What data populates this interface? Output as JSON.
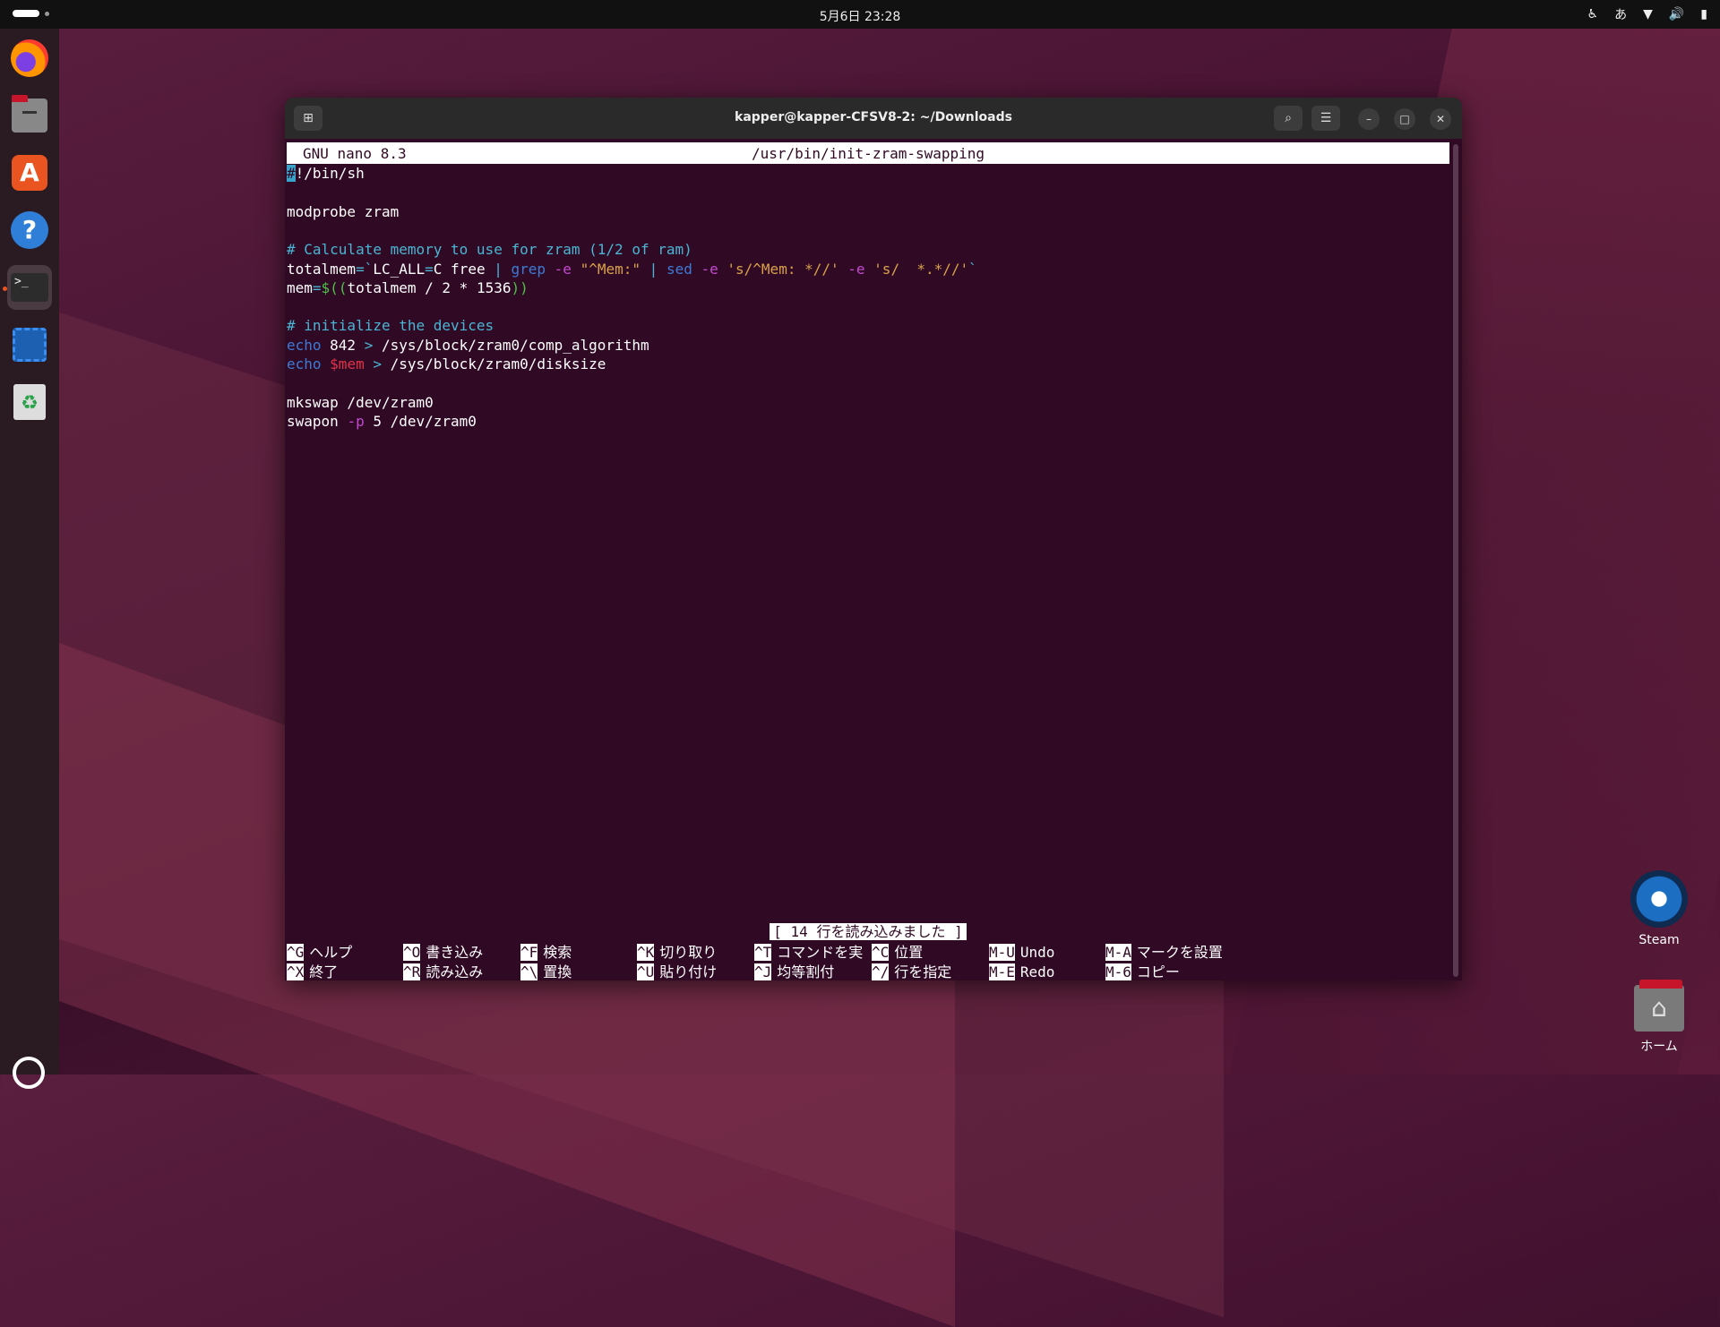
{
  "topbar": {
    "clock": "5月6日  23:28",
    "ime": "あ"
  },
  "dock": {
    "items": [
      {
        "name": "firefox",
        "active": false
      },
      {
        "name": "files",
        "active": false
      },
      {
        "name": "app-center",
        "active": false
      },
      {
        "name": "help",
        "active": false
      },
      {
        "name": "terminal",
        "active": true,
        "label": ">_"
      },
      {
        "name": "screenshot",
        "active": false
      },
      {
        "name": "trash",
        "active": false
      }
    ]
  },
  "desktop": {
    "steam_label": "Steam",
    "home_label": "ホーム"
  },
  "window": {
    "title": "kapper@kapper-CFSV8-2: ~/Downloads"
  },
  "nano": {
    "version": "GNU nano 8.3",
    "filename": "/usr/bin/init-zram-swapping",
    "status": "[ 14 行を読み込みました ]",
    "shortcuts": [
      {
        "key": "^G",
        "label": "ヘルプ"
      },
      {
        "key": "^O",
        "label": "書き込み"
      },
      {
        "key": "^F",
        "label": "検索"
      },
      {
        "key": "^K",
        "label": "切り取り"
      },
      {
        "key": "^T",
        "label": "コマンドを実"
      },
      {
        "key": "^C",
        "label": "位置"
      },
      {
        "key": "M-U",
        "label": "Undo"
      },
      {
        "key": "M-A",
        "label": "マークを設置"
      },
      {
        "key": "^X",
        "label": "終了"
      },
      {
        "key": "^R",
        "label": "読み込み"
      },
      {
        "key": "^\\",
        "label": "置換"
      },
      {
        "key": "^U",
        "label": "貼り付け"
      },
      {
        "key": "^J",
        "label": "均等割付"
      },
      {
        "key": "^/",
        "label": "行を指定"
      },
      {
        "key": "M-E",
        "label": "Redo"
      },
      {
        "key": "M-6",
        "label": "コピー"
      }
    ],
    "code": [
      {
        "t": "#!/bin/sh"
      },
      {
        "t": ""
      },
      {
        "t": "modprobe zram"
      },
      {
        "t": ""
      },
      {
        "t": "# Calculate memory to use for zram (1/2 of ram)"
      },
      {
        "t": "totalmem=`LC_ALL=C free | grep -e \"^Mem:\" | sed -e 's/^Mem: *//' -e 's/  *.*//'`"
      },
      {
        "t": "mem=$((totalmem / 2 * 1536))"
      },
      {
        "t": ""
      },
      {
        "t": "# initialize the devices"
      },
      {
        "t": "echo 842 > /sys/block/zram0/comp_algorithm"
      },
      {
        "t": "echo $mem > /sys/block/zram0/disksize"
      },
      {
        "t": ""
      },
      {
        "t": "mkswap /dev/zram0"
      },
      {
        "t": "swapon -p 5 /dev/zram0"
      }
    ]
  },
  "colors": {
    "terminal_bg": "#300a24",
    "accent": "#e95420",
    "comment": "#4ab5d4",
    "keyword": "#3d7bd6",
    "string": "#d9a24a",
    "flag": "#c24ad0",
    "variable": "#e0334a"
  }
}
